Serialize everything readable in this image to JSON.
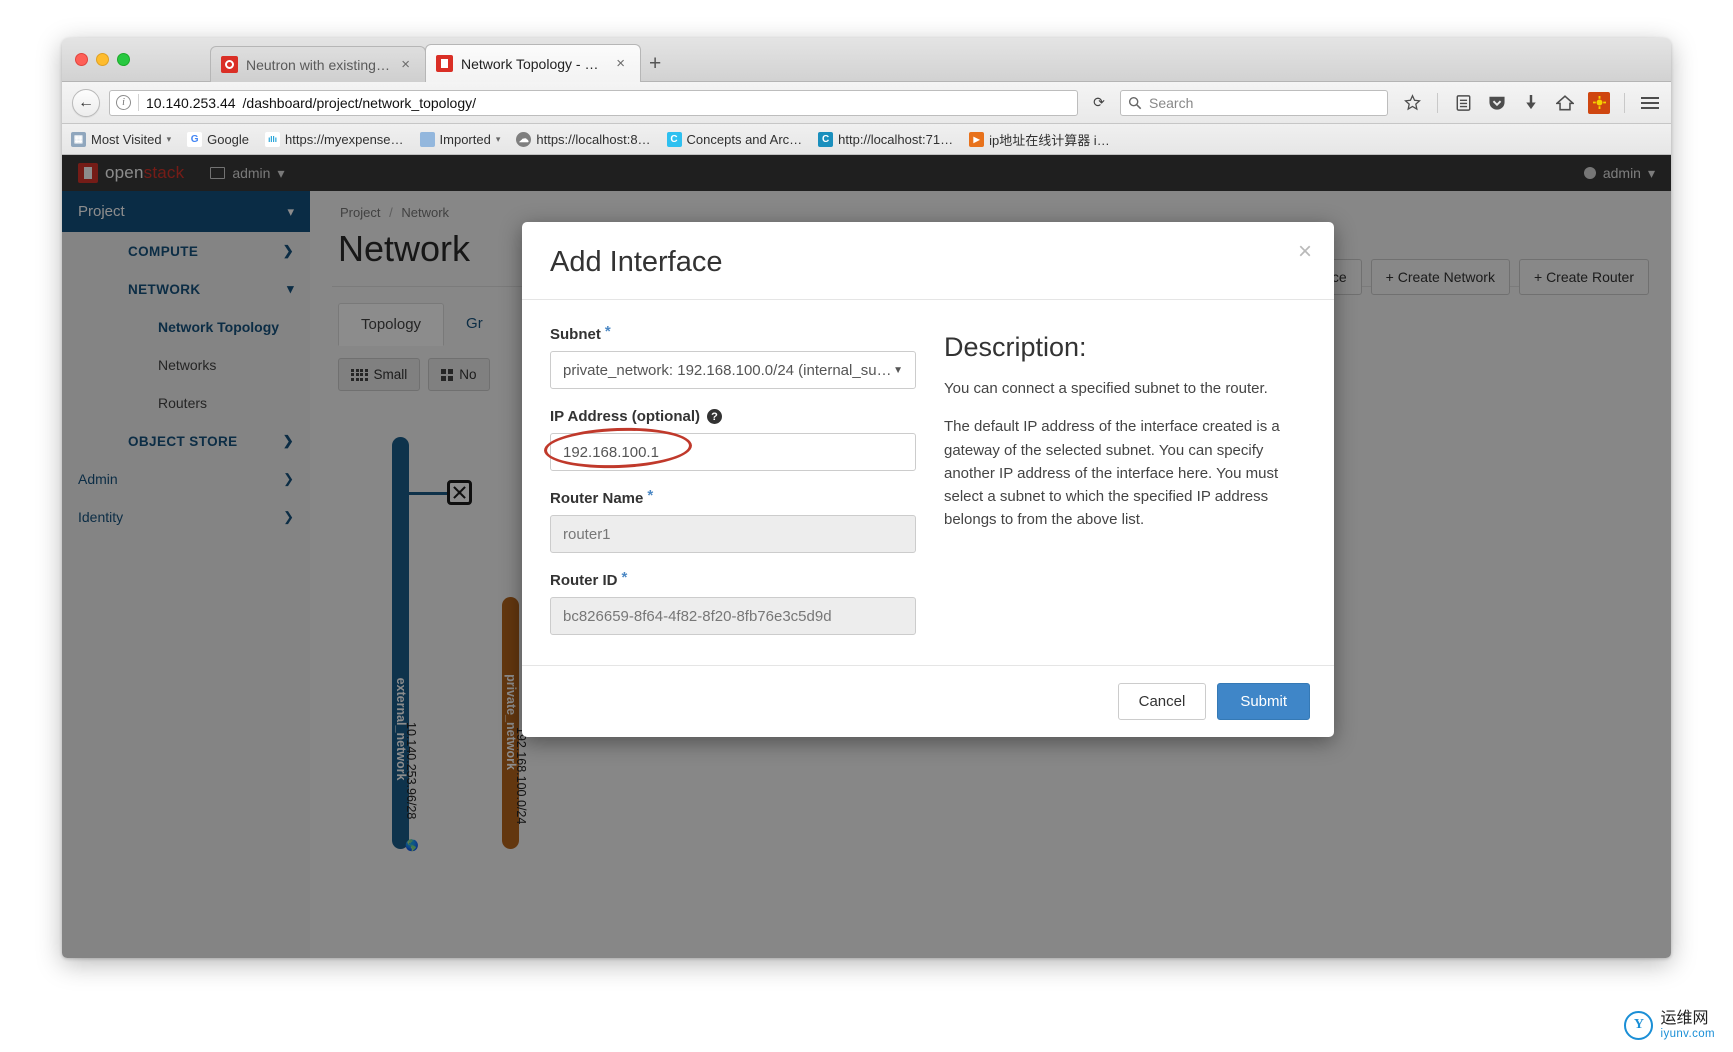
{
  "browser": {
    "tabs": [
      {
        "title": "Neutron with existing exter…",
        "favicon": "neutron-favicon",
        "active": false,
        "close_label": "×"
      },
      {
        "title": "Network Topology - OpenS…",
        "favicon": "openstack-favicon",
        "active": true,
        "close_label": "×"
      }
    ],
    "new_tab_label": "+",
    "back_label": "←",
    "url_host": "10.140.253.44",
    "url_path": "/dashboard/project/network_topology/",
    "reload_label": "⟳",
    "search_placeholder": "Search",
    "search_value": "",
    "toolbar_icons": [
      "star-icon",
      "reader-icon",
      "pocket-icon",
      "download-icon",
      "home-icon",
      "extension-icon",
      "menu-icon"
    ],
    "bookmarks": [
      {
        "label": "Most Visited",
        "icon_letter": "❖",
        "icon_color": "#8fa6bd",
        "has_caret": true
      },
      {
        "label": "Google",
        "icon_letter": "G",
        "icon_color": "#ffffff",
        "has_caret": false
      },
      {
        "label": "https://myexpense…",
        "icon_letter": "c",
        "icon_color": "#ffffff",
        "has_caret": false
      },
      {
        "label": "Imported",
        "icon_letter": "",
        "icon_color": "#93b7dd",
        "has_caret": true
      },
      {
        "label": "https://localhost:8…",
        "icon_letter": "⊕",
        "icon_color": "#7f7f7f",
        "has_caret": false
      },
      {
        "label": "Concepts and Arc…",
        "icon_letter": "C",
        "icon_color": "#2ec0f0",
        "has_caret": false
      },
      {
        "label": "http://localhost:71…",
        "icon_letter": "C",
        "icon_color": "#1a8fbd",
        "has_caret": false
      },
      {
        "label": "ip地址在线计算器 i…",
        "icon_letter": "▶",
        "icon_color": "#e8721c",
        "has_caret": false
      }
    ]
  },
  "openstack": {
    "logo_pre": "open",
    "logo_post": "stack",
    "project_switcher": "admin",
    "user_menu": "admin",
    "sidebar": {
      "project_label": "Project",
      "items": [
        {
          "label": "COMPUTE",
          "level": "group",
          "chevron": "›"
        },
        {
          "label": "NETWORK",
          "level": "group",
          "chevron": "⌄"
        },
        {
          "label": "Network Topology",
          "level": "sub-active",
          "chevron": ""
        },
        {
          "label": "Networks",
          "level": "sub",
          "chevron": ""
        },
        {
          "label": "Routers",
          "level": "sub",
          "chevron": ""
        },
        {
          "label": "OBJECT STORE",
          "level": "group",
          "chevron": "›"
        },
        {
          "label": "Admin",
          "level": "top",
          "chevron": "›"
        },
        {
          "label": "Identity",
          "level": "top",
          "chevron": "›"
        }
      ]
    },
    "breadcrumb": {
      "root": "Project",
      "sep": "/",
      "current": "Network"
    },
    "page_title": "Network",
    "actions": [
      {
        "label": "Instance",
        "icon": ""
      },
      {
        "label": "Create Network",
        "icon": "+"
      },
      {
        "label": "Create Router",
        "icon": "+"
      }
    ],
    "view_tabs": [
      {
        "label": "Topology",
        "active": true
      },
      {
        "label": "Gr",
        "active": false
      }
    ],
    "size_buttons": [
      {
        "label": "Small",
        "icon": "small-grid-icon",
        "active": true
      },
      {
        "label": "No",
        "icon": "normal-grid-icon",
        "active": false
      }
    ],
    "topology": {
      "networks": [
        {
          "name": "external_network",
          "cidr": "10.140.253.96/28",
          "color": "#1b5e8a",
          "external": true,
          "globe_icon": "globe-icon"
        },
        {
          "name": "private_network",
          "cidr": "192.168.100.0/24",
          "color": "#b5651d",
          "external": false,
          "globe_icon": ""
        }
      ],
      "router_node": "router-node-icon"
    }
  },
  "modal": {
    "title": "Add Interface",
    "close_label": "×",
    "fields": {
      "subnet": {
        "label": "Subnet",
        "required_mark": "*",
        "value": "private_network: 192.168.100.0/24 (internal_su…",
        "caret": "▼"
      },
      "ip_address": {
        "label": "IP Address (optional)",
        "help_icon": "help-icon",
        "help_glyph": "?",
        "value": "192.168.100.1",
        "annotated": true,
        "annotation_color": "#c0392b"
      },
      "router_name": {
        "label": "Router Name",
        "required_mark": "*",
        "value": "router1",
        "disabled": true
      },
      "router_id": {
        "label": "Router ID",
        "required_mark": "*",
        "value": "bc826659-8f64-4f82-8f20-8fb76e3c5d9d",
        "disabled": true
      }
    },
    "description": {
      "heading": "Description:",
      "paragraphs": [
        "You can connect a specified subnet to the router.",
        "The default IP address of the interface created is a gateway of the selected subnet. You can specify another IP address of the interface here. You must select a subnet to which the specified IP address belongs to from the above list."
      ]
    },
    "cancel_label": "Cancel",
    "submit_label": "Submit"
  },
  "watermark": {
    "mark": "Y",
    "line1": "运维网",
    "line2": "iyunv.com"
  }
}
